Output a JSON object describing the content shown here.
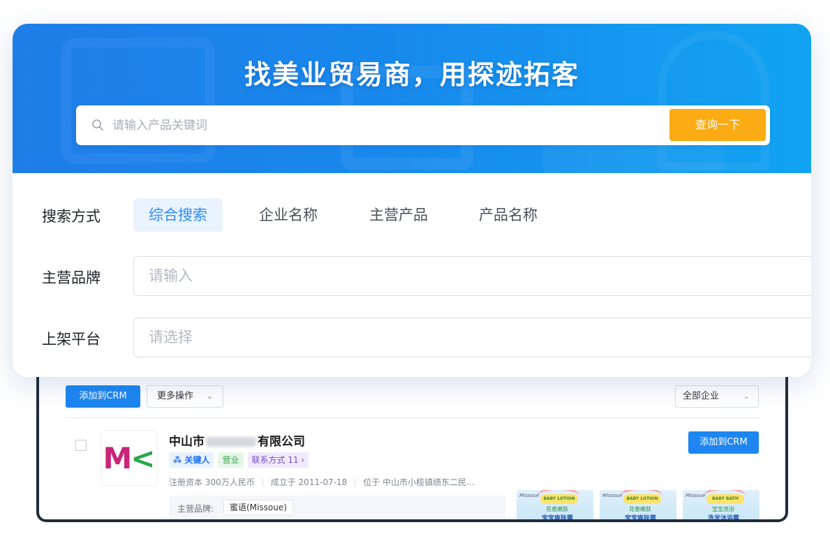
{
  "hero": {
    "title": "找美业贸易商，用探迹拓客",
    "search_placeholder": "请输入产品关键词",
    "search_button": "查询一下"
  },
  "form": {
    "mode_label": "搜索方式",
    "modes": [
      "综合搜索",
      "企业名称",
      "主营产品",
      "产品名称"
    ],
    "active_mode": "综合搜索",
    "brand_label": "主营品牌",
    "brand_placeholder": "请输入",
    "platform_label": "上架平台",
    "platform_placeholder": "请选择"
  },
  "results": {
    "toolbar": {
      "add_crm": "添加到CRM",
      "more_actions": "更多操作",
      "filter_all": "全部企业"
    },
    "company": {
      "logo_text_1": "M",
      "logo_text_2": "<",
      "name_prefix": "中山市",
      "name_suffix": "有限公司",
      "tags": {
        "key_person": "关键人",
        "status": "营业",
        "contact": "联系方式 11 ›"
      },
      "capital": "注册资本 300万人民币",
      "founded": "成立于 2011-07-18",
      "location": "位于 中山市小榄镇绩东二民...",
      "add_crm": "添加到CRM",
      "brand_label": "主营品牌:",
      "brand_value": "蜜语(Missoue)",
      "thumbs": [
        {
          "ribbon": "BABY LOTION",
          "line1": "花香嫩肤",
          "line2": "宝宝爽肤露"
        },
        {
          "ribbon": "BABY LOTION",
          "line1": "花香嫩肤",
          "line2": "宝宝爽肤露"
        },
        {
          "ribbon": "BABY BATH",
          "line1": "宝宝洗浴",
          "line2": "洗发沐浴露"
        }
      ]
    }
  },
  "colors": {
    "brand_blue": "#1d86f0",
    "cta_orange": "#fbab13",
    "active_tab_bg": "#e9f3ff"
  }
}
